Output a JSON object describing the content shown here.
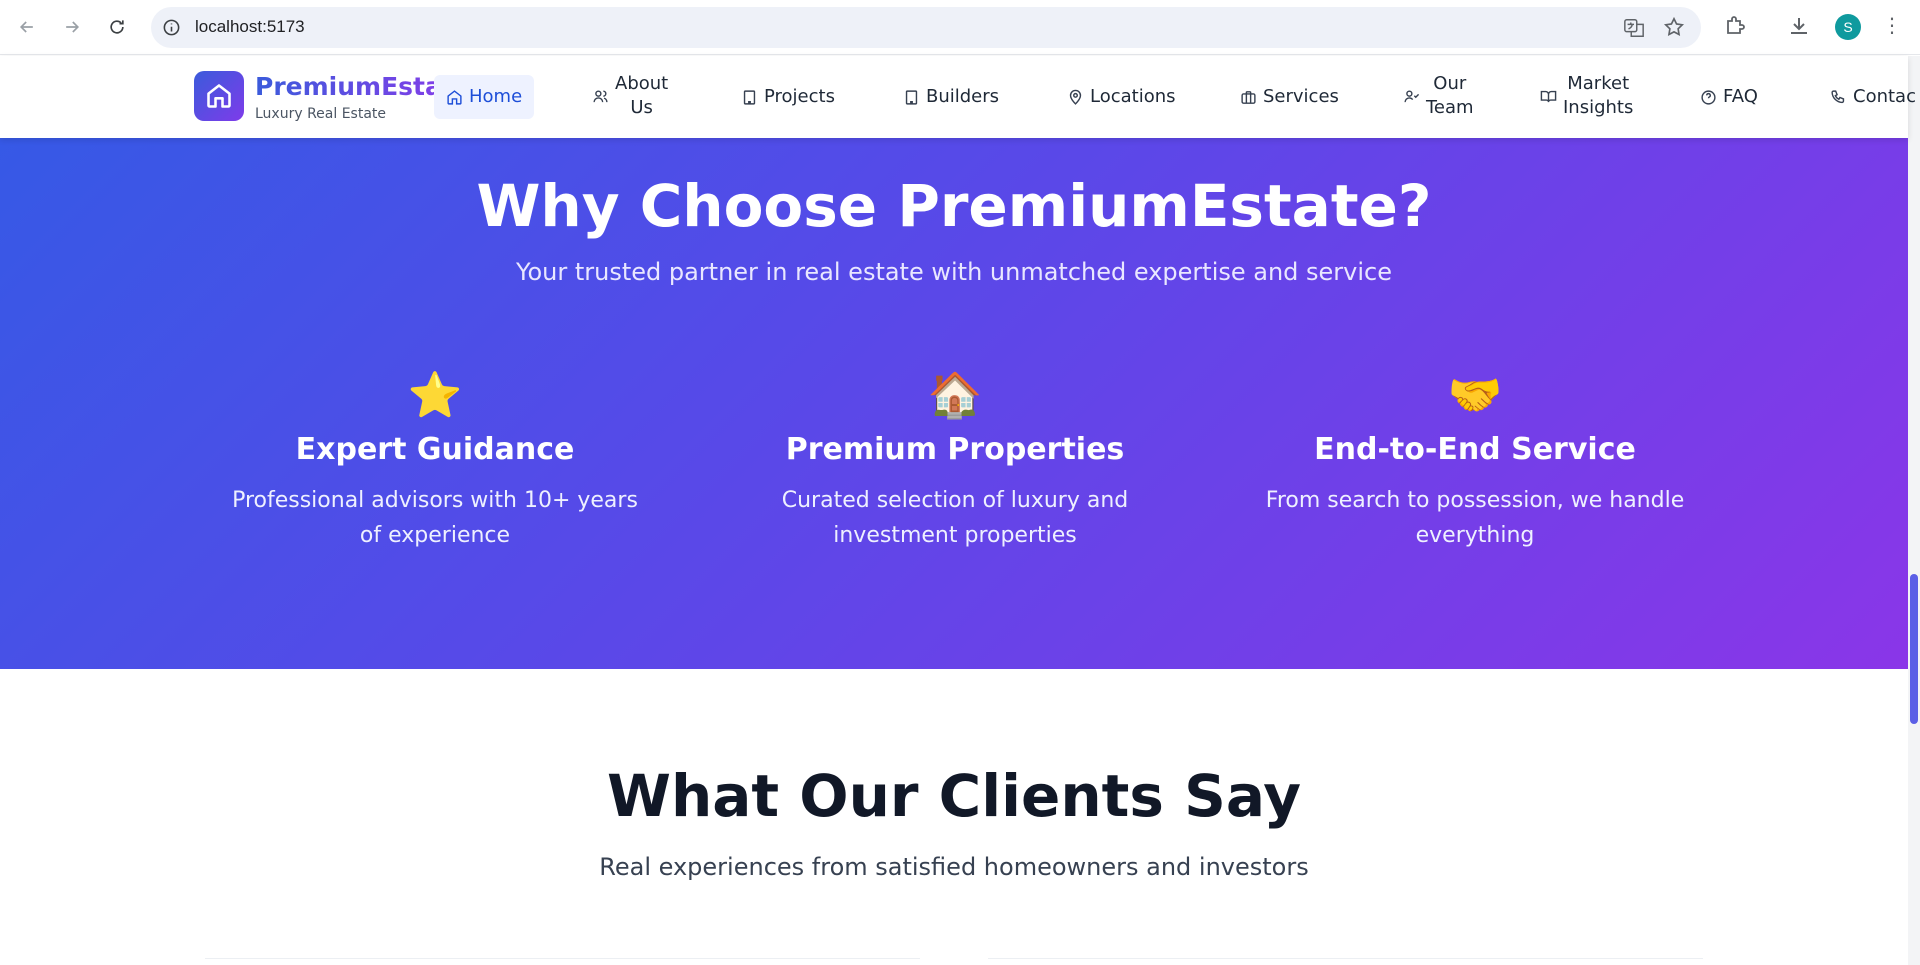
{
  "browser": {
    "url": "localhost:5173",
    "profile_initial": "S",
    "icons": [
      "back-icon",
      "forward-icon",
      "reload-icon",
      "site-info-icon",
      "translate-icon",
      "bookmark-star-icon",
      "extensions-icon",
      "download-icon"
    ]
  },
  "header": {
    "brand": "PremiumEstate",
    "tagline": "Luxury Real Estate",
    "nav": [
      {
        "label": "Home",
        "icon": "home-icon",
        "active": true
      },
      {
        "label": "About\nUs",
        "icon": "users-icon"
      },
      {
        "label": "Projects",
        "icon": "building-icon"
      },
      {
        "label": "Builders",
        "icon": "building-icon"
      },
      {
        "label": "Locations",
        "icon": "map-pin-icon"
      },
      {
        "label": "Services",
        "icon": "briefcase-icon"
      },
      {
        "label": "Our\nTeam",
        "icon": "user-check-icon"
      },
      {
        "label": "Market\nInsights",
        "icon": "book-open-icon"
      },
      {
        "label": "FAQ",
        "icon": "help-circle-icon"
      },
      {
        "label": "Contac",
        "icon": "phone-icon"
      }
    ]
  },
  "why": {
    "title": "Why Choose PremiumEstate?",
    "subtitle": "Your trusted partner in real estate with unmatched expertise and service",
    "features": [
      {
        "emoji": "⭐",
        "title": "Expert Guidance",
        "text": "Professional advisors with 10+ years of experience"
      },
      {
        "emoji": "🏠",
        "title": "Premium Properties",
        "text": "Curated selection of luxury and investment properties"
      },
      {
        "emoji": "🤝",
        "title": "End-to-End Service",
        "text": "From search to possession, we handle everything"
      }
    ]
  },
  "clients": {
    "title": "What Our Clients Say",
    "subtitle": "Real experiences from satisfied homeowners and investors"
  },
  "colors": {
    "gradient_start": "#3659e6",
    "gradient_end": "#8a36e8",
    "active_nav": "#1d4ed8",
    "avatar": "#0f9a9e"
  }
}
